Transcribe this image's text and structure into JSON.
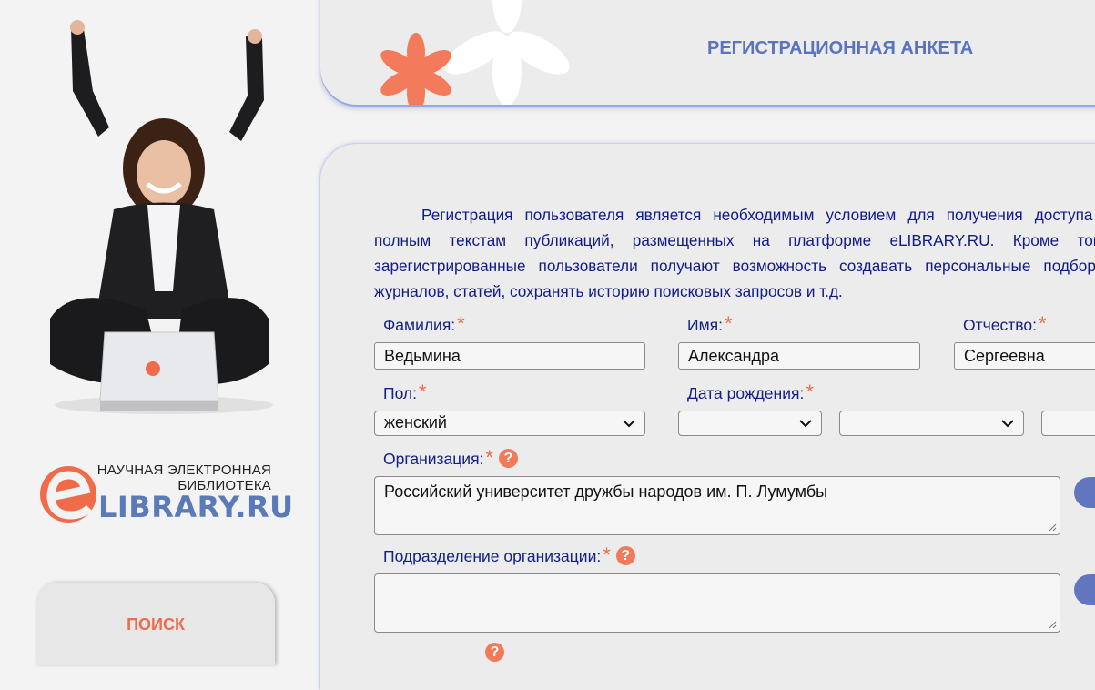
{
  "header": {
    "title": "РЕГИСТРАЦИОННАЯ АНКЕТА"
  },
  "logo": {
    "line1": "НАУЧНАЯ ЭЛЕКТРОННАЯ",
    "line2": "БИБЛИОТЕКА",
    "brand": "LIBRARY.RU",
    "letter": "e"
  },
  "sidebar": {
    "search_tab": "ПОИСК"
  },
  "intro": "Регистрация пользователя является необходимым условием для получения доступа к полным текстам публикаций, размещенных на платформе eLIBRARY.RU. Кроме того, зарегистрированные пользователи получают возможность создавать персональные подборки журналов, статей, сохранять историю поисковых запросов и т.д.",
  "form": {
    "required_mark": "*",
    "help_glyph": "?",
    "lastname": {
      "label": "Фамилия:",
      "value": "Ведьмина"
    },
    "firstname": {
      "label": "Имя:",
      "value": "Александра"
    },
    "patronymic": {
      "label": "Отчество:",
      "value": "Сергеевна"
    },
    "gender": {
      "label": "Пол:",
      "value": "женский"
    },
    "birthdate": {
      "label": "Дата рождения:",
      "day": "",
      "month": "",
      "year": ""
    },
    "organization": {
      "label": "Организация:",
      "value": "Российский университет дружбы народов им. П. Лумумбы"
    },
    "department": {
      "label": "Подразделение организации:",
      "value": ""
    }
  },
  "colors": {
    "accent_orange": "#ef6b4a",
    "label_blue": "#142086",
    "title_blue": "#5c74bf",
    "button_blue": "#6276c0"
  }
}
